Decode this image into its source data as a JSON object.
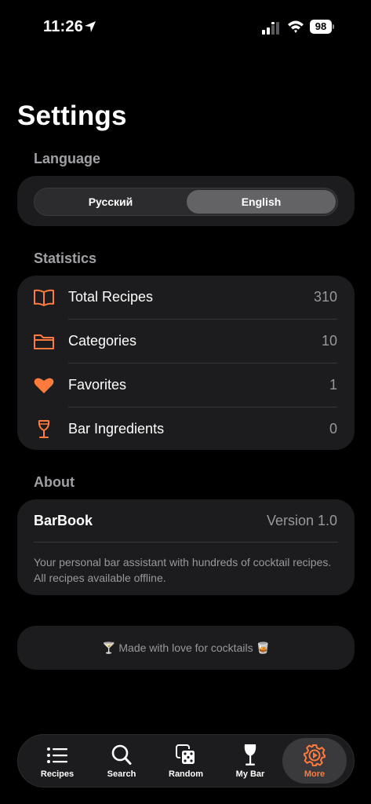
{
  "status_bar": {
    "time": "11:26",
    "battery": "98"
  },
  "page": {
    "title": "Settings"
  },
  "language": {
    "header": "Language",
    "options": [
      "Русский",
      "English"
    ],
    "selected": "English"
  },
  "statistics": {
    "header": "Statistics",
    "rows": [
      {
        "label": "Total Recipes",
        "value": "310",
        "icon": "book-icon"
      },
      {
        "label": "Categories",
        "value": "10",
        "icon": "folder-icon"
      },
      {
        "label": "Favorites",
        "value": "1",
        "icon": "heart-icon"
      },
      {
        "label": "Bar Ingredients",
        "value": "0",
        "icon": "wine-glass-icon"
      }
    ]
  },
  "about": {
    "header": "About",
    "app_name": "BarBook",
    "version": "Version 1.0",
    "description": "Your personal bar assistant with hundreds of cocktail recipes. All recipes available offline."
  },
  "footer": {
    "made_with": "🍸 Made with love for cocktails 🥃"
  },
  "tab_bar": {
    "tabs": [
      {
        "label": "Recipes",
        "icon": "list-icon"
      },
      {
        "label": "Search",
        "icon": "search-icon"
      },
      {
        "label": "Random",
        "icon": "dice-icon"
      },
      {
        "label": "My Bar",
        "icon": "wine-glass-icon"
      },
      {
        "label": "More",
        "icon": "gear-icon"
      }
    ],
    "active": "More"
  },
  "colors": {
    "accent": "#ff7a3d",
    "background": "#000000",
    "card": "#1c1c1e",
    "secondary_text": "#98989d"
  }
}
